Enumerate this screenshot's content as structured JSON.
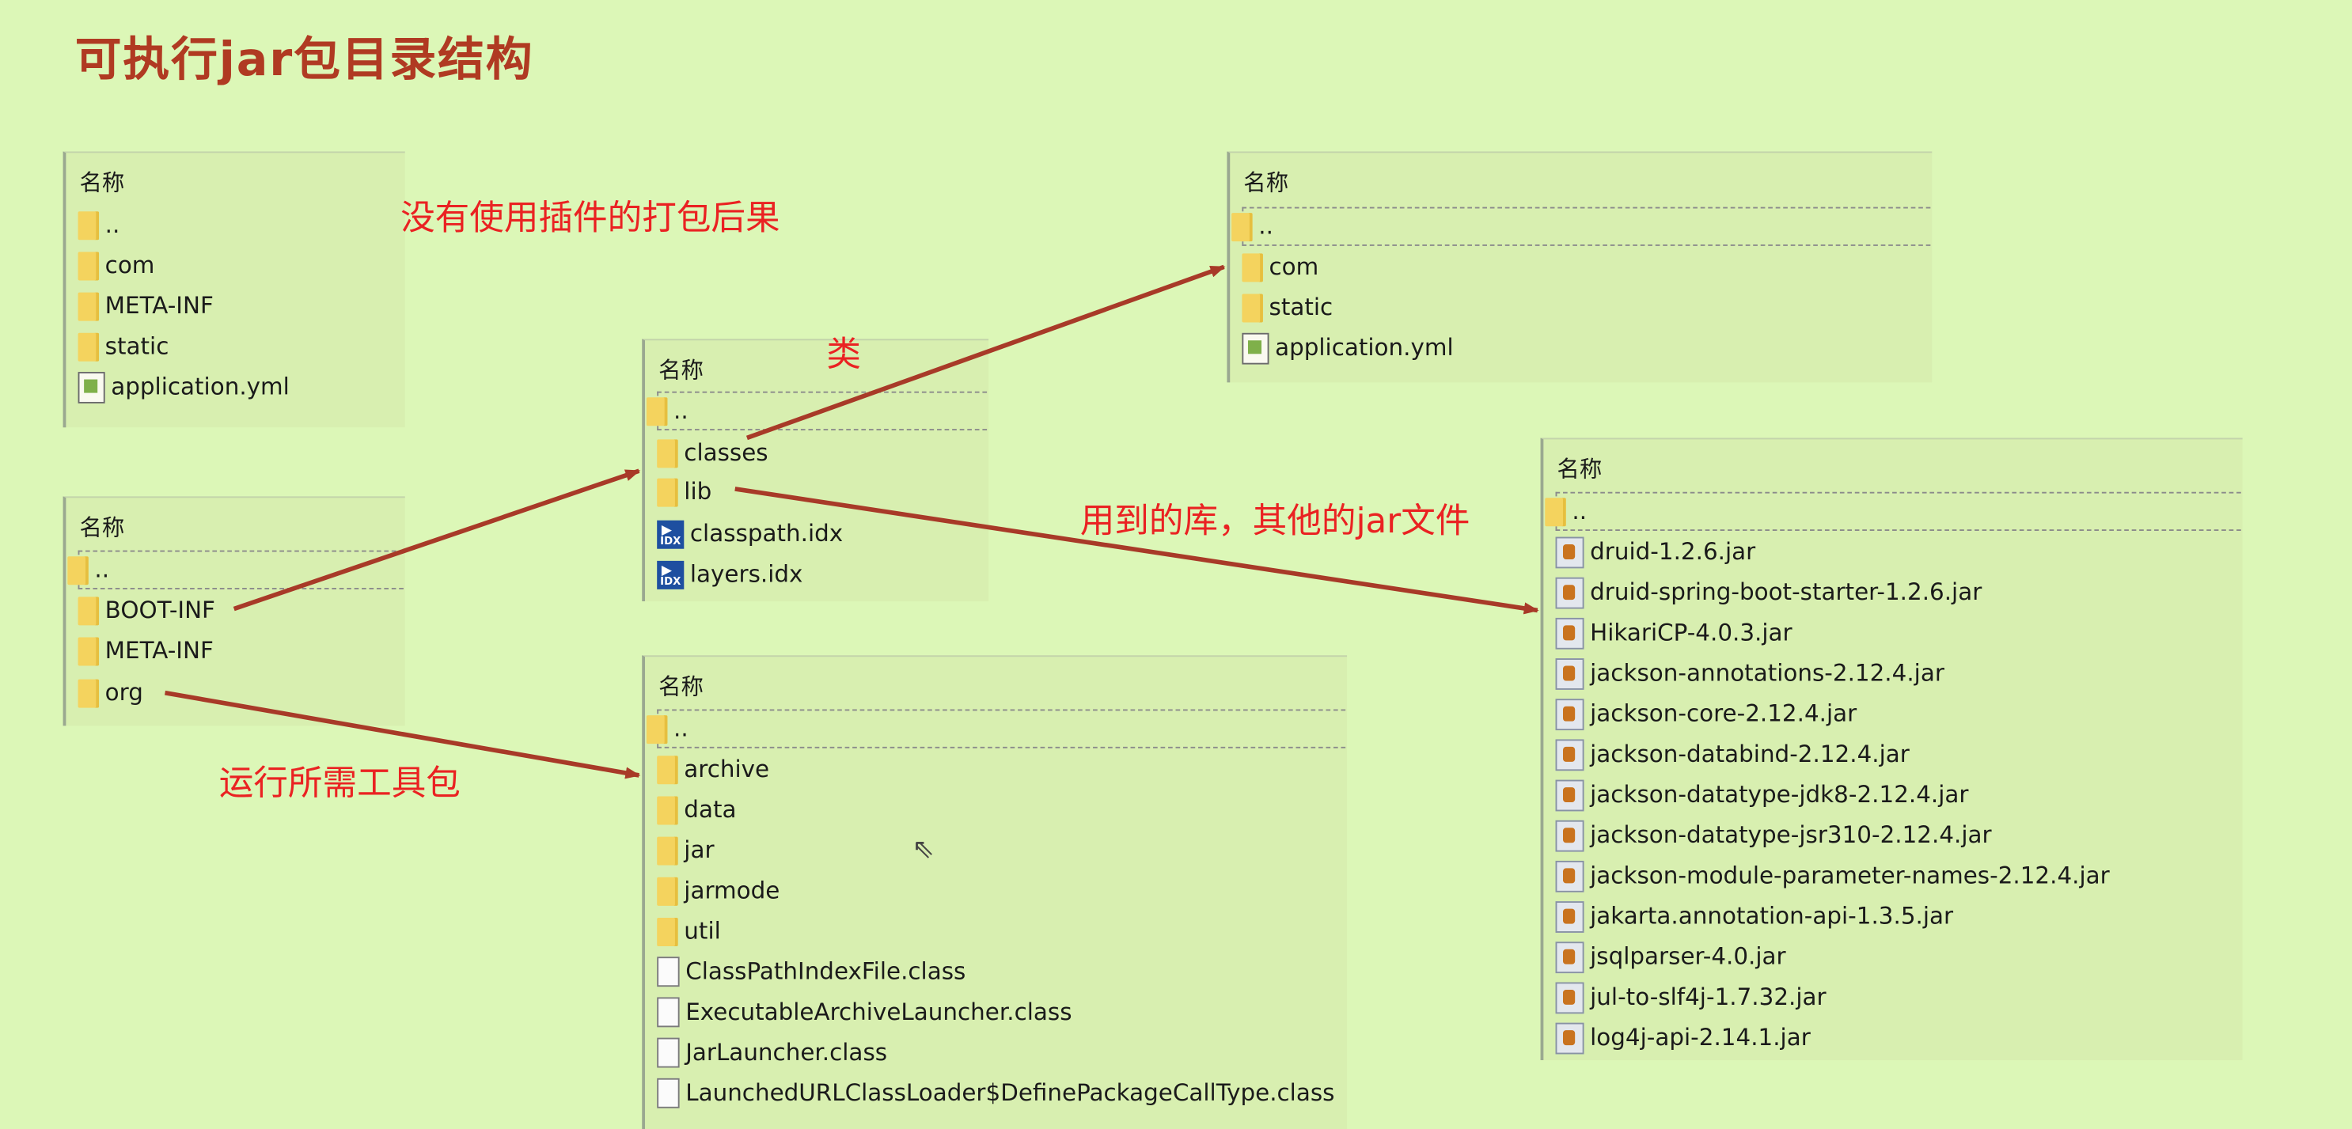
{
  "title": "可执行jar包目录结构",
  "column_header": "名称",
  "annotations": {
    "no_plugin": "没有使用插件的打包后果",
    "classes": "类",
    "libs": "用到的库，其他的jar文件",
    "tools": "运行所需工具包"
  },
  "colors": {
    "background": "#dcf7b7",
    "title": "#b03a22",
    "annotation": "#ea2222",
    "arrow": "#a83a28"
  },
  "panel1": {
    "items": [
      {
        "name": "..",
        "icon": "folder-icon"
      },
      {
        "name": "com",
        "icon": "folder-icon"
      },
      {
        "name": "META-INF",
        "icon": "folder-icon"
      },
      {
        "name": "static",
        "icon": "folder-icon"
      },
      {
        "name": "application.yml",
        "icon": "yml-file-icon"
      }
    ]
  },
  "panel2": {
    "items": [
      {
        "name": "..",
        "icon": "folder-icon"
      },
      {
        "name": "BOOT-INF",
        "icon": "folder-icon"
      },
      {
        "name": "META-INF",
        "icon": "folder-icon"
      },
      {
        "name": "org",
        "icon": "folder-icon"
      }
    ]
  },
  "panel3": {
    "items": [
      {
        "name": "..",
        "icon": "folder-icon"
      },
      {
        "name": "classes",
        "icon": "folder-icon"
      },
      {
        "name": "lib",
        "icon": "folder-icon"
      },
      {
        "name": "classpath.idx",
        "icon": "idx-file-icon"
      },
      {
        "name": "layers.idx",
        "icon": "idx-file-icon"
      }
    ]
  },
  "panel4": {
    "items": [
      {
        "name": "..",
        "icon": "folder-icon"
      },
      {
        "name": "com",
        "icon": "folder-icon"
      },
      {
        "name": "static",
        "icon": "folder-icon"
      },
      {
        "name": "application.yml",
        "icon": "yml-file-icon"
      }
    ]
  },
  "panel5": {
    "items": [
      {
        "name": "..",
        "icon": "folder-icon"
      },
      {
        "name": "archive",
        "icon": "folder-icon"
      },
      {
        "name": "data",
        "icon": "folder-icon"
      },
      {
        "name": "jar",
        "icon": "folder-icon"
      },
      {
        "name": "jarmode",
        "icon": "folder-icon"
      },
      {
        "name": "util",
        "icon": "folder-icon"
      },
      {
        "name": "ClassPathIndexFile.class",
        "icon": "class-file-icon"
      },
      {
        "name": "ExecutableArchiveLauncher.class",
        "icon": "class-file-icon"
      },
      {
        "name": "JarLauncher.class",
        "icon": "class-file-icon"
      },
      {
        "name": "LaunchedURLClassLoader$DefinePackageCallType.class",
        "icon": "class-file-icon"
      }
    ]
  },
  "panel6": {
    "items": [
      {
        "name": "..",
        "icon": "folder-icon"
      },
      {
        "name": "druid-1.2.6.jar",
        "icon": "jar-file-icon"
      },
      {
        "name": "druid-spring-boot-starter-1.2.6.jar",
        "icon": "jar-file-icon"
      },
      {
        "name": "HikariCP-4.0.3.jar",
        "icon": "jar-file-icon"
      },
      {
        "name": "jackson-annotations-2.12.4.jar",
        "icon": "jar-file-icon"
      },
      {
        "name": "jackson-core-2.12.4.jar",
        "icon": "jar-file-icon"
      },
      {
        "name": "jackson-databind-2.12.4.jar",
        "icon": "jar-file-icon"
      },
      {
        "name": "jackson-datatype-jdk8-2.12.4.jar",
        "icon": "jar-file-icon"
      },
      {
        "name": "jackson-datatype-jsr310-2.12.4.jar",
        "icon": "jar-file-icon"
      },
      {
        "name": "jackson-module-parameter-names-2.12.4.jar",
        "icon": "jar-file-icon"
      },
      {
        "name": "jakarta.annotation-api-1.3.5.jar",
        "icon": "jar-file-icon"
      },
      {
        "name": "jsqlparser-4.0.jar",
        "icon": "jar-file-icon"
      },
      {
        "name": "jul-to-slf4j-1.7.32.jar",
        "icon": "jar-file-icon"
      },
      {
        "name": "log4j-api-2.14.1.jar",
        "icon": "jar-file-icon"
      }
    ]
  }
}
